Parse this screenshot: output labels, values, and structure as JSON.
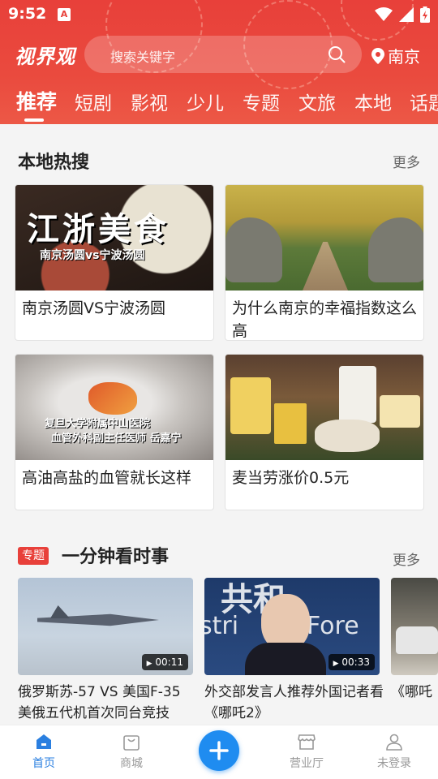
{
  "status_bar": {
    "time": "9:52",
    "app_badge": "A"
  },
  "header": {
    "logo": "视界观",
    "search_placeholder": "搜索关键字",
    "location": "南京"
  },
  "tabs": [
    "推荐",
    "短剧",
    "影视",
    "少儿",
    "专题",
    "文旅",
    "本地",
    "话题"
  ],
  "local_hot": {
    "title": "本地热搜",
    "more": "更多",
    "cards": [
      {
        "title": "南京汤圆VS宁波汤圆",
        "img_big_text": "江浙美食",
        "img_sub_text": "南京汤圆vs宁波汤圆"
      },
      {
        "title": "为什么南京的幸福指数这么高"
      },
      {
        "title": "高油高盐的血管就长这样",
        "img_caption_1": "复旦大学附属中山医院",
        "img_caption_2": "血管外科副主任医师 岳嘉宁"
      },
      {
        "title": "麦当劳涨价0.5元"
      }
    ]
  },
  "minute_news": {
    "tag": "专题",
    "title": "一分钟看时事",
    "more": "更多",
    "videos": [
      {
        "title": "俄罗斯苏-57 VS 美国F-35 美俄五代机首次同台竞技",
        "duration": "00:11"
      },
      {
        "title": "外交部发言人推荐外国记者看《哪吒2》",
        "duration": "00:33",
        "bg_text_1": "共和",
        "bg_text_2": "Fore",
        "bg_text_3": "stri"
      },
      {
        "title": "《哪吒"
      }
    ]
  },
  "bottom_nav": {
    "items": [
      {
        "label": "首页",
        "icon": "home-icon"
      },
      {
        "label": "商城",
        "icon": "shopping-bag-icon"
      },
      {
        "label": "",
        "icon": "plus-icon"
      },
      {
        "label": "营业厅",
        "icon": "store-icon"
      },
      {
        "label": "未登录",
        "icon": "user-icon"
      }
    ]
  },
  "colors": {
    "brand_red": "#e8403a",
    "accent_blue": "#1f8cf0",
    "active_nav": "#2a7fe0"
  }
}
